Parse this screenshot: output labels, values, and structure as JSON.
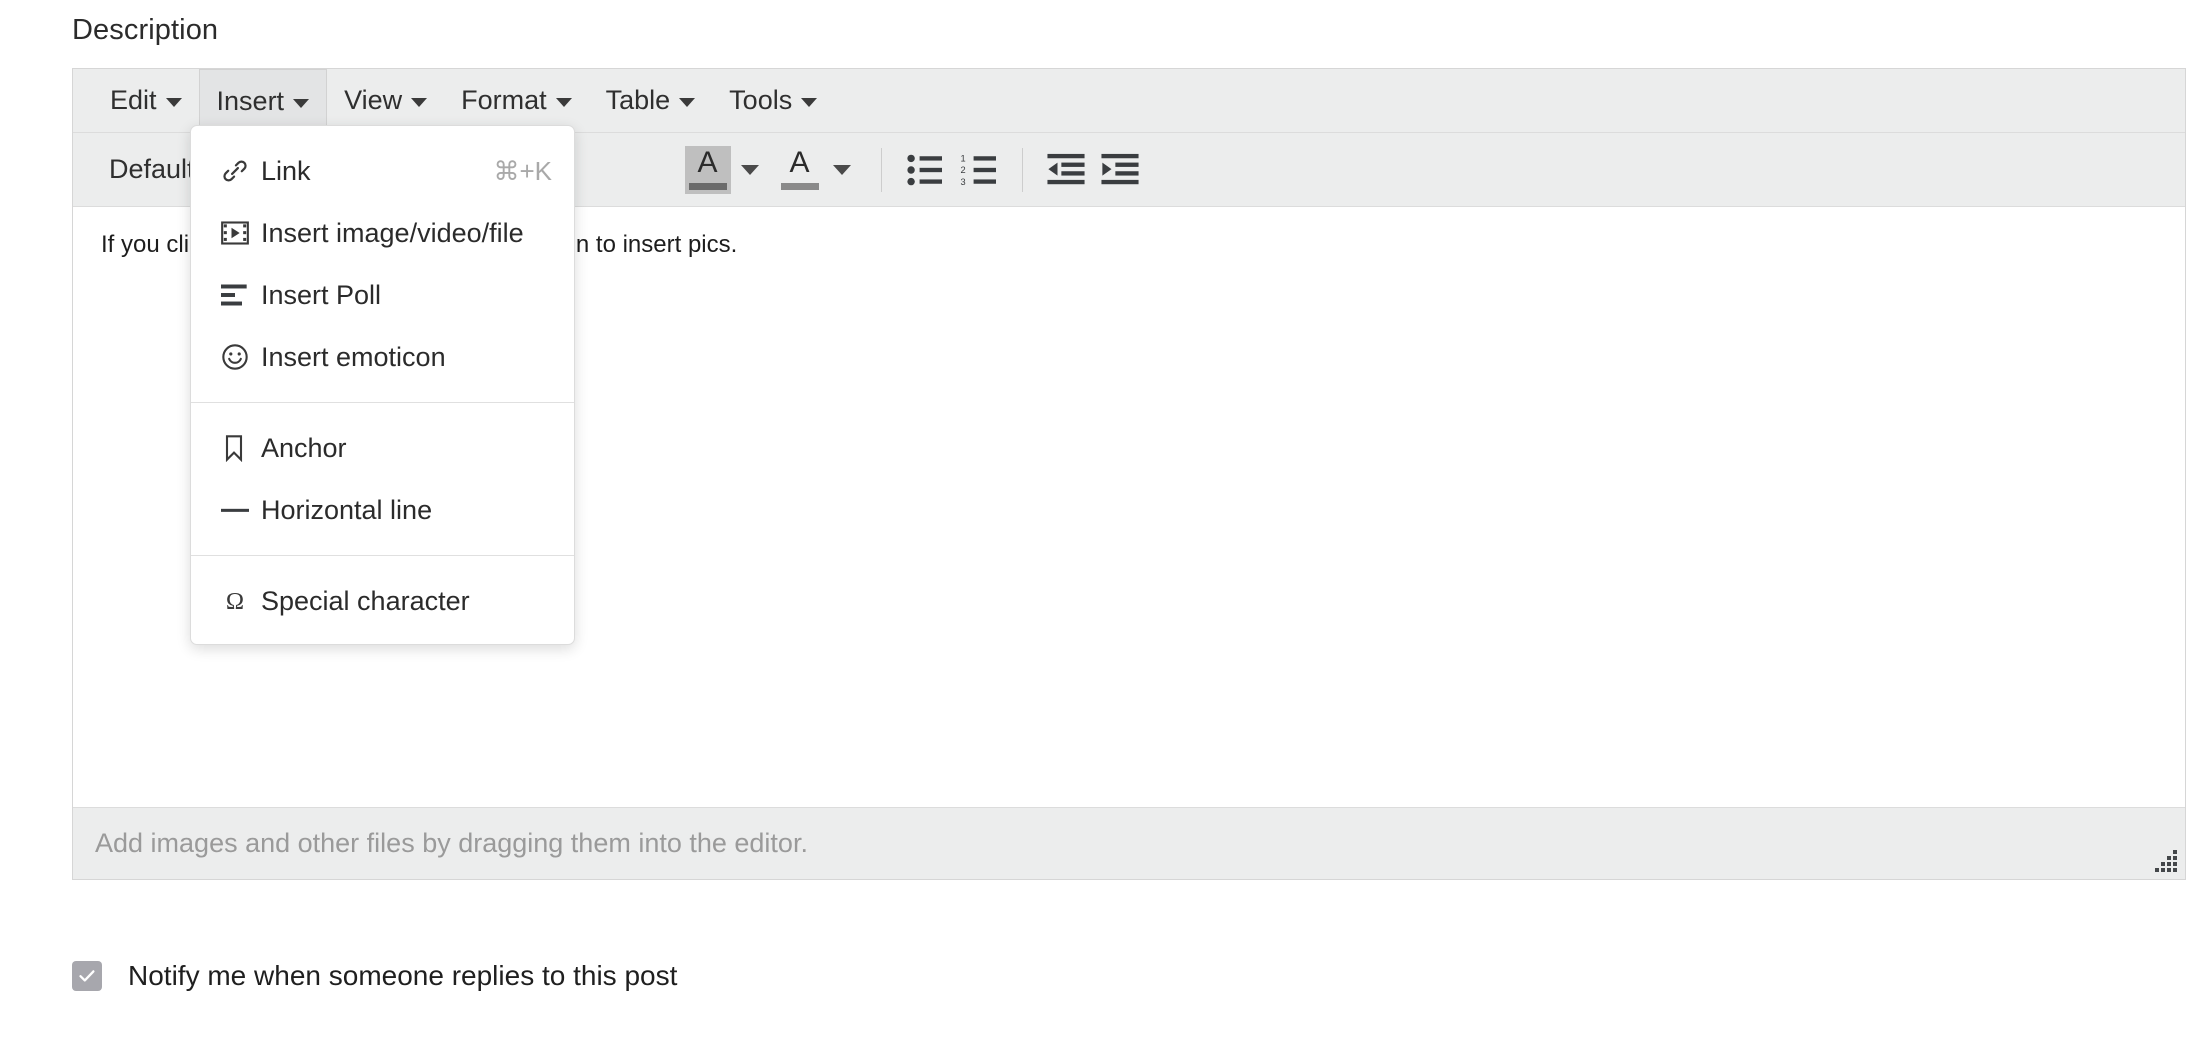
{
  "field": {
    "label": "Description"
  },
  "menubar": {
    "items": [
      {
        "label": "Edit",
        "name": "menu-edit",
        "active": false
      },
      {
        "label": "Insert",
        "name": "menu-insert",
        "active": true
      },
      {
        "label": "View",
        "name": "menu-view",
        "active": false
      },
      {
        "label": "Format",
        "name": "menu-format",
        "active": false
      },
      {
        "label": "Table",
        "name": "menu-table",
        "active": false
      },
      {
        "label": "Tools",
        "name": "menu-tools",
        "active": false
      }
    ]
  },
  "toolbar": {
    "format_select": "Default",
    "buttons": [
      {
        "name": "text-color-button",
        "icon": "letter-a-foreground-color-icon"
      },
      {
        "name": "text-color-dropdown",
        "icon": "chevron-down-icon"
      },
      {
        "name": "background-color-button",
        "icon": "letter-a-background-color-icon"
      },
      {
        "name": "background-color-dropdown",
        "icon": "chevron-down-icon"
      },
      {
        "name": "bullet-list-button",
        "icon": "bullet-list-icon"
      },
      {
        "name": "numbered-list-button",
        "icon": "numbered-list-icon"
      },
      {
        "name": "outdent-button",
        "icon": "outdent-icon"
      },
      {
        "name": "indent-button",
        "icon": "indent-icon"
      }
    ]
  },
  "insert_menu": {
    "groups": [
      {
        "items": [
          {
            "label": "Link",
            "shortcut": "⌘+K",
            "icon": "link-icon"
          },
          {
            "label": "Insert image/video/file",
            "shortcut": "",
            "icon": "media-film-icon"
          },
          {
            "label": "Insert Poll",
            "shortcut": "",
            "icon": "poll-icon"
          },
          {
            "label": "Insert emoticon",
            "shortcut": "",
            "icon": "smiley-face-icon"
          }
        ]
      },
      {
        "items": [
          {
            "label": "Anchor",
            "shortcut": "",
            "icon": "bookmark-icon"
          },
          {
            "label": "Horizontal line",
            "shortcut": "",
            "icon": "horizontal-line-icon"
          }
        ]
      },
      {
        "items": [
          {
            "label": "Special character",
            "shortcut": "",
            "icon": "omega-icon"
          }
        ]
      }
    ]
  },
  "body": {
    "text_before": "If you clic",
    "text_after": "ar with an option to insert pics.",
    "full_text": "If you click Insert, the menu bar with an option to insert pics."
  },
  "dropzone": {
    "text": "Add images and other files by dragging them into the editor."
  },
  "notify": {
    "label": "Notify me when someone replies to this post",
    "checked": true
  },
  "colors": {
    "toolbar_bg": "#eceded",
    "border": "#d6d6d6",
    "text": "#2b2b2b",
    "muted": "#9a9a9a",
    "checkbox": "#a7a7ad"
  }
}
